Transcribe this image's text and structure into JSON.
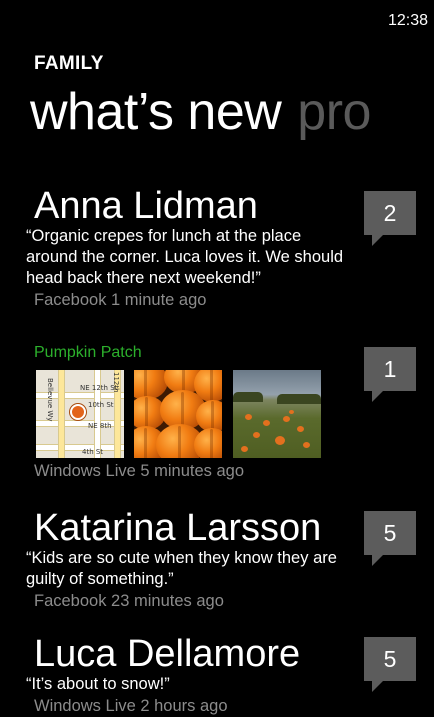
{
  "status": {
    "time": "12:38"
  },
  "header": {
    "group": "FAMILY"
  },
  "pivot": {
    "active": "what’s new",
    "next": "pro"
  },
  "feed": [
    {
      "name": "Anna Lidman",
      "text": "“Organic crepes for lunch at the place around the corner. Luca loves it. We should head back there next weekend!”",
      "meta": "Facebook 1 minute ago",
      "count": "2"
    },
    {
      "album": "Pumpkin Patch",
      "meta": "Windows Live 5 minutes ago",
      "count": "1",
      "map_labels": [
        "NE 12th St",
        "10th St",
        "NE 8th",
        "4th St",
        "Bellevue Wy",
        "112th"
      ]
    },
    {
      "name": "Katarina Larsson",
      "text": "“Kids are so cute when they know they are guilty of something.”",
      "meta": "Facebook 23 minutes ago",
      "count": "5"
    },
    {
      "name": "Luca Dellamore",
      "text": "“It’s about to snow!”",
      "meta": "Windows Live 2 hours ago",
      "count": "5"
    }
  ],
  "colors": {
    "accent": "#2cb02c",
    "badge": "#5c5c5c",
    "subtle": "#8c8c8c",
    "pumpkin": "#f17c12"
  }
}
